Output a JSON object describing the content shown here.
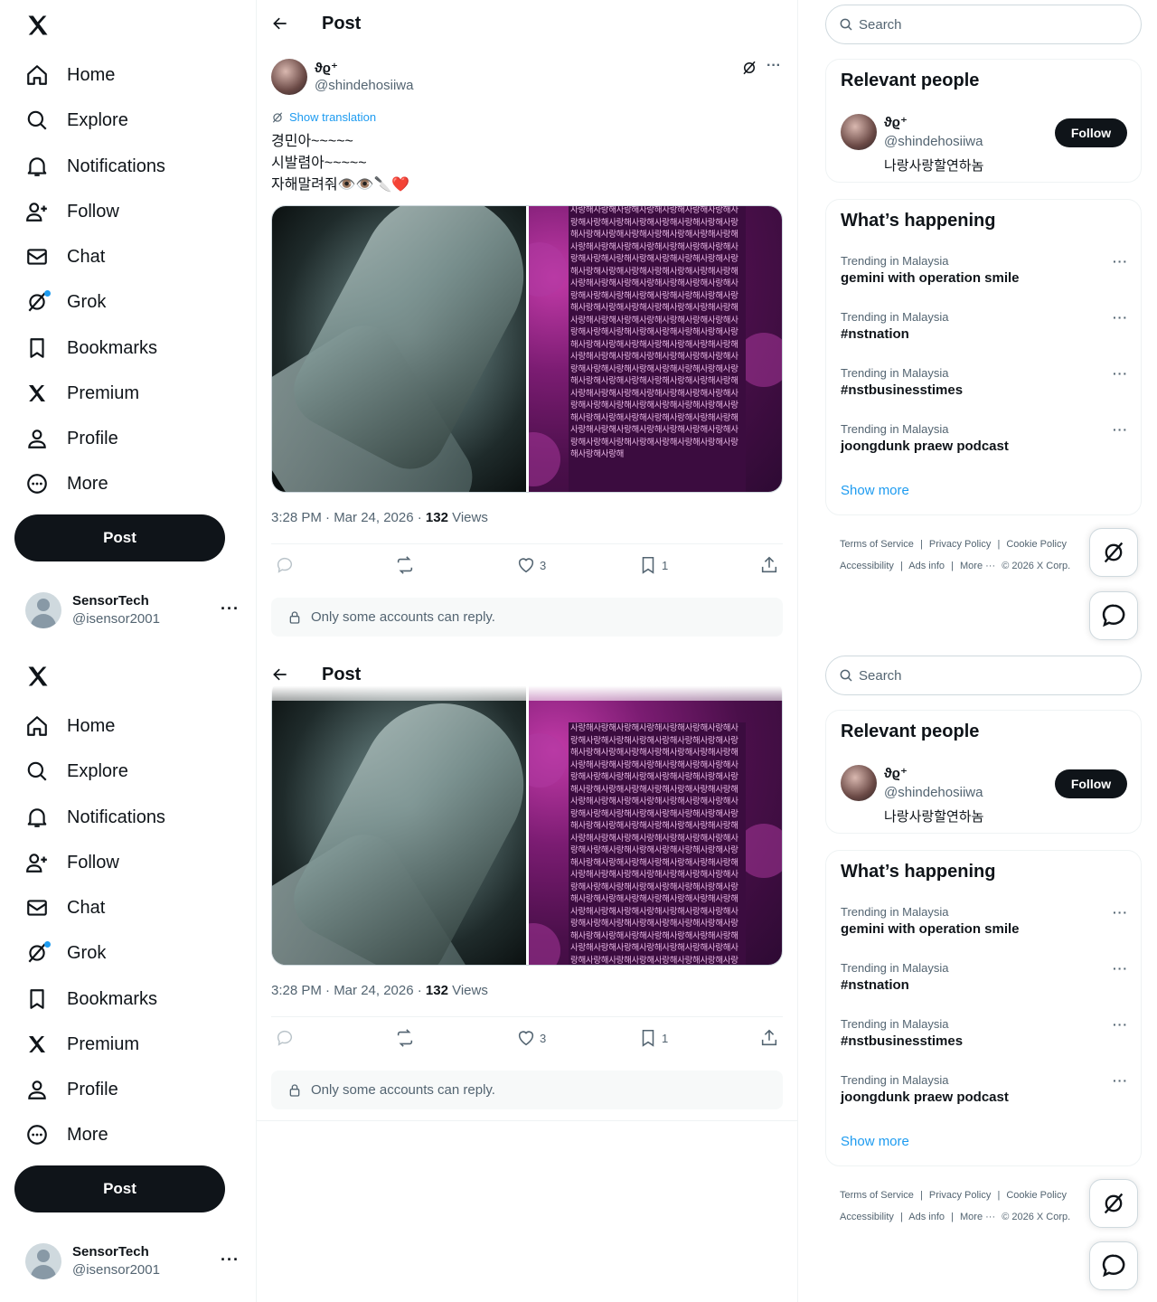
{
  "nav": {
    "items": [
      {
        "label": "Home",
        "icon": "home-icon"
      },
      {
        "label": "Explore",
        "icon": "search-icon"
      },
      {
        "label": "Notifications",
        "icon": "bell-icon"
      },
      {
        "label": "Follow",
        "icon": "add-person-icon"
      },
      {
        "label": "Chat",
        "icon": "envelope-icon"
      },
      {
        "label": "Grok",
        "icon": "grok-icon"
      },
      {
        "label": "Bookmarks",
        "icon": "bookmark-icon"
      },
      {
        "label": "Premium",
        "icon": "x-logo-icon"
      },
      {
        "label": "Profile",
        "icon": "person-icon"
      },
      {
        "label": "More",
        "icon": "more-circle-icon"
      }
    ],
    "post_button": "Post"
  },
  "account": {
    "name": "SensorTech",
    "handle": "@isensor2001",
    "more": "···"
  },
  "header": {
    "title": "Post"
  },
  "post": {
    "author_name": "ϑϱ⁺",
    "author_handle": "@shindehosiiwa",
    "more": "···",
    "translation_link": "Show translation",
    "lines": [
      "경민아~~~~~",
      "시발렴아~~~~~",
      "자해말려줘👁️👁️🔪❤️"
    ],
    "image_text": "사랑해사랑해사랑해사랑해사랑해사랑해사랑해사랑해사랑해사랑해사랑해사랑해사랑해사랑해사랑해사랑해사랑해사랑해사랑해사랑해사랑해사랑해사랑해사랑해사랑해사랑해사랑해사랑해사랑해사랑해사랑해사랑해사랑해사랑해사랑해사랑해사랑해사랑해사랑해사랑해사랑해사랑해사랑해사랑해사랑해사랑해사랑해사랑해사랑해사랑해사랑해사랑해사랑해사랑해사랑해사랑해사랑해사랑해사랑해사랑해사랑해사랑해사랑해사랑해사랑해사랑해사랑해사랑해사랑해사랑해사랑해사랑해사랑해사랑해사랑해사랑해사랑해사랑해사랑해사랑해사랑해사랑해사랑해사랑해사랑해사랑해사랑해사랑해사랑해사랑해사랑해사랑해사랑해사랑해사랑해사랑해사랑해사랑해사랑해사랑해사랑해사랑해사랑해사랑해사랑해사랑해사랑해사랑해사랑해사랑해사랑해사랑해사랑해사랑해사랑해사랑해사랑해사랑해사랑해사랑해사랑해사랑해사랑해사랑해사랑해사랑해사랑해사랑해사랑해사랑해사랑해사랑해사랑해사랑해사랑해사랑해사랑해사랑해사랑해사랑해사랑해사랑해사랑해사랑해사랑해사랑해사랑해사랑해사랑해",
    "time": "3:28 PM · Mar 24, 2026 · ",
    "views_count": "132",
    "views_label": " Views",
    "likes": "3",
    "bookmarks": "1",
    "reply_restriction": "Only some accounts can reply."
  },
  "search": {
    "placeholder": "Search"
  },
  "relevant": {
    "title": "Relevant people",
    "name": "ϑϱ⁺",
    "handle": "@shindehosiiwa",
    "bio": "나랑사랑할연하놈",
    "follow": "Follow"
  },
  "happening": {
    "title": "What’s happening",
    "trends": [
      {
        "context": "Trending in Malaysia",
        "topic": "gemini with operation smile"
      },
      {
        "context": "Trending in Malaysia",
        "topic": "#nstnation"
      },
      {
        "context": "Trending in Malaysia",
        "topic": "#nstbusinesstimes"
      },
      {
        "context": "Trending in Malaysia",
        "topic": "joongdunk praew podcast"
      }
    ],
    "show_more": "Show more"
  },
  "footer": {
    "line1": [
      "Terms of Service",
      "|",
      "Privacy Policy",
      "|",
      "Cookie Policy"
    ],
    "line2": [
      "Accessibility",
      "|",
      "Ads info",
      "|",
      "More ···",
      "© 2026 X Corp."
    ]
  }
}
